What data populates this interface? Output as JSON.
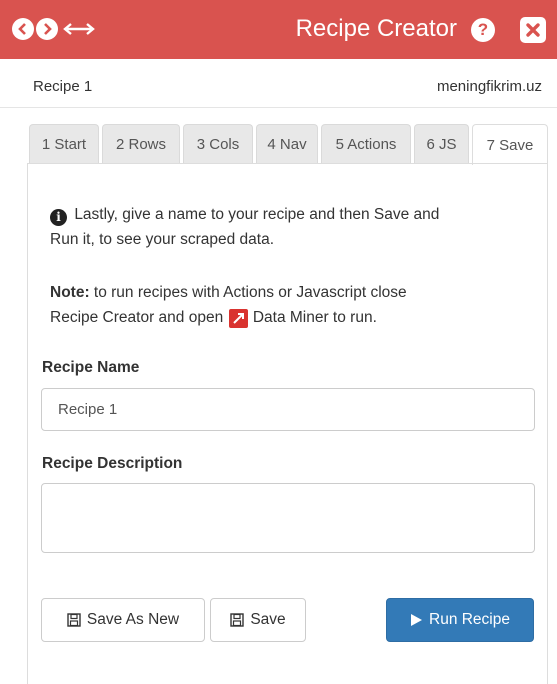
{
  "window": {
    "title": "Recipe Creator",
    "help_label": "?",
    "accent_color": "#d9534f"
  },
  "recipe_bar": {
    "recipe_name": "Recipe 1",
    "site": "meningfikrim.uz"
  },
  "tabs": [
    {
      "label": "1 Start",
      "active": false
    },
    {
      "label": "2 Rows",
      "active": false
    },
    {
      "label": "3 Cols",
      "active": false
    },
    {
      "label": "4 Nav",
      "active": false
    },
    {
      "label": "5 Actions",
      "active": false
    },
    {
      "label": "6 JS",
      "active": false
    },
    {
      "label": "7 Save",
      "active": true
    }
  ],
  "panel": {
    "intro_line1": "Lastly, give a name to your recipe and then Save and",
    "intro_line2": "Run it, to see your scraped data.",
    "note_label": "Note:",
    "note_line1_rest": " to run recipes with Actions or Javascript close",
    "note_line2_a": "Recipe Creator and open ",
    "note_line2_b": " Data Miner to run.",
    "name_label": "Recipe Name",
    "name_value": "Recipe 1",
    "desc_label": "Recipe Description",
    "desc_value": "",
    "save_as_new_label": "Save As New",
    "save_label": "Save",
    "run_label": "Run Recipe"
  }
}
